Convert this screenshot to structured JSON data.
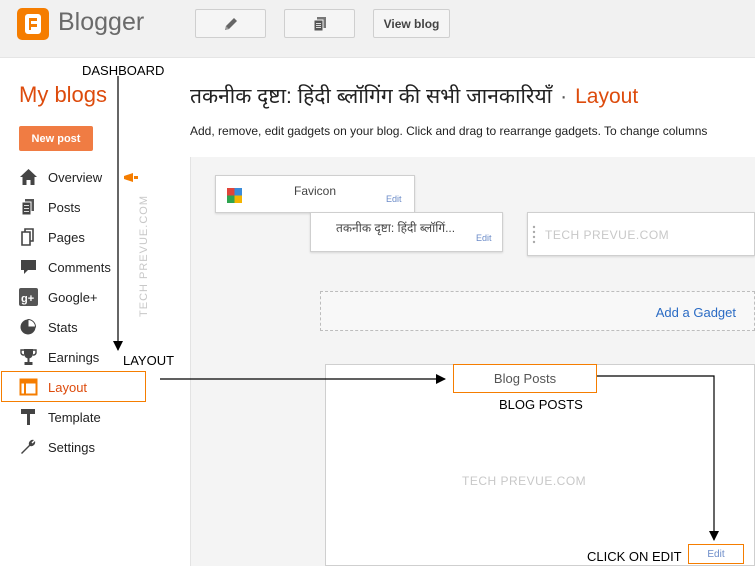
{
  "header": {
    "app_name": "Blogger",
    "view_blog_label": "View blog",
    "my_blogs_label": "My blogs",
    "blog_title": "तकनीक दृष्टा: हिंदी ब्लॉगिंग की सभी जानकारियाँ",
    "separator": "·",
    "page_name": "Layout",
    "description": "Add, remove, edit gadgets on your blog. Click and drag to rearrange gadgets. To change columns"
  },
  "sidebar": {
    "new_post_label": "New post",
    "items": [
      {
        "label": "Overview",
        "icon": "home-icon"
      },
      {
        "label": "Posts",
        "icon": "posts-icon"
      },
      {
        "label": "Pages",
        "icon": "pages-icon"
      },
      {
        "label": "Comments",
        "icon": "comments-icon"
      },
      {
        "label": "Google+",
        "icon": "google-plus-icon"
      },
      {
        "label": "Stats",
        "icon": "stats-icon"
      },
      {
        "label": "Earnings",
        "icon": "trophy-icon"
      },
      {
        "label": "Layout",
        "icon": "layout-icon"
      },
      {
        "label": "Template",
        "icon": "template-icon"
      },
      {
        "label": "Settings",
        "icon": "wrench-icon"
      }
    ]
  },
  "gadgets": {
    "favicon_label": "Favicon",
    "header_gadget_label": "तकनीक दृष्टा: हिंदी ब्लॉगिं...",
    "edit_label": "Edit",
    "add_gadget_label": "Add a Gadget",
    "blog_posts_label": "Blog Posts"
  },
  "annotations": {
    "dashboard": "DASHBOARD",
    "layout": "LAYOUT",
    "blog_posts": "BLOG POSTS",
    "click_on_edit": "CLICK ON EDIT"
  },
  "watermark": "TECH PREVUE.COM",
  "colors": {
    "accent": "#f57d00",
    "link": "#2a6bc4"
  }
}
